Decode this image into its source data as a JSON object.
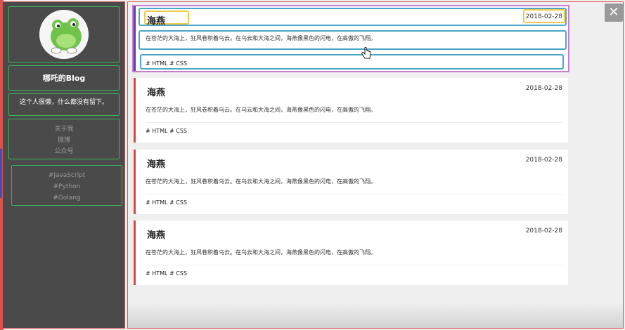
{
  "sidebar": {
    "blog_name": "哪吒的Blog",
    "motto": "这个人很懒，什么都没有留下。",
    "links": [
      "关于我",
      "微博",
      "公众号"
    ],
    "tags": [
      "#JavaScript",
      "#Python",
      "#Golang"
    ]
  },
  "posts": [
    {
      "title": "海燕",
      "date": "2018-02-28",
      "excerpt": "在苍茫的大海上，狂风卷积着乌云。在乌云和大海之间，海燕像黑色的闪电，在高傲的飞翔。",
      "tags": "# HTML # CSS"
    },
    {
      "title": "海燕",
      "date": "2018-02-28",
      "excerpt": "在苍茫的大海上，狂风卷积着乌云。在乌云和大海之间，海燕像黑色的闪电，在高傲的飞翔。",
      "tags": "# HTML # CSS"
    },
    {
      "title": "海燕",
      "date": "2018-02-28",
      "excerpt": "在苍茫的大海上，狂风卷积着乌云。在乌云和大海之间，海燕像黑色的闪电，在高傲的飞翔。",
      "tags": "# HTML # CSS"
    },
    {
      "title": "海燕",
      "date": "2018-02-28",
      "excerpt": "在苍茫的大海上，狂风卷积着乌云。在乌云和大海之间，海燕像黑色的闪电，在高傲的飞翔。",
      "tags": "# HTML # CSS"
    }
  ],
  "ui": {
    "close_glyph": "✕"
  },
  "colors": {
    "sidebar_bg": "#4a4a4a",
    "box_outline": "#3cb55a",
    "accent_left_border": "#d24a43",
    "highlight_blue": "#49a6c9",
    "highlight_yellow": "#f0c94a",
    "highlight_purple": "#c77dd6"
  }
}
